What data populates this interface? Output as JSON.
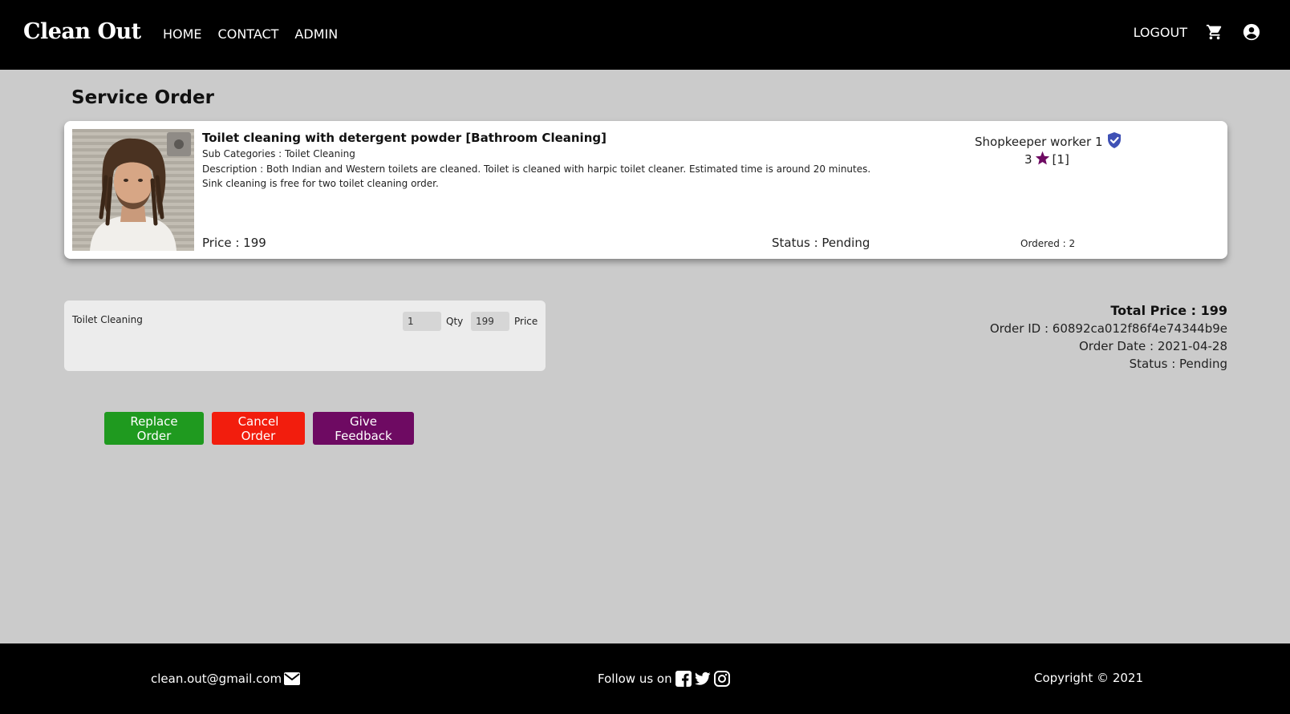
{
  "navbar": {
    "brand": "Clean Out",
    "links": [
      "HOME",
      "CONTACT",
      "ADMIN"
    ],
    "logout": "LOGOUT",
    "cart_icon": "cart-icon",
    "account_icon": "user-circle-icon"
  },
  "page_title": "Service Order",
  "service": {
    "name": "Toilet cleaning with detergent powder [Bathroom Cleaning]",
    "sub_categories": "Sub Categories : Toilet Cleaning",
    "description": "Description : Both Indian and Western toilets are cleaned. Toilet is cleaned with harpic toilet cleaner. Estimated time is around 20 minutes. Sink cleaning is free for two toilet cleaning order.",
    "price": "Price : 199",
    "status": "Status : Pending",
    "worker": "Shopkeeper worker 1",
    "rating_value": "3",
    "rating_count": "[1]",
    "ordered": "Ordered : 2",
    "verified_icon": "verified-badge-icon",
    "star_icon": "star-icon"
  },
  "order_item": {
    "name": "Toilet Cleaning",
    "qty": "1",
    "qty_label": "Qty",
    "price": "199",
    "price_label": "Price"
  },
  "summary": {
    "total": "Total Price : 199",
    "order_id": "Order ID : 60892ca012f86f4e74344b9e",
    "order_date": "Order Date : 2021-04-28",
    "status": "Status : Pending"
  },
  "actions": {
    "replace": "Replace Order",
    "cancel": "Cancel Order",
    "feedback": "Give Feedback"
  },
  "footer": {
    "email": "clean.out@gmail.com",
    "follow": "Follow us on",
    "copyright": "Copyright © 2021"
  },
  "colors": {
    "navbar_bg": "#000000",
    "page_bg": "#cbcbcb",
    "replace_btn": "#1f9a1f",
    "cancel_btn": "#f21d0d",
    "feedback_btn": "#6e0a62",
    "star": "#6e0a62",
    "verified_badge": "#3f51b5"
  }
}
